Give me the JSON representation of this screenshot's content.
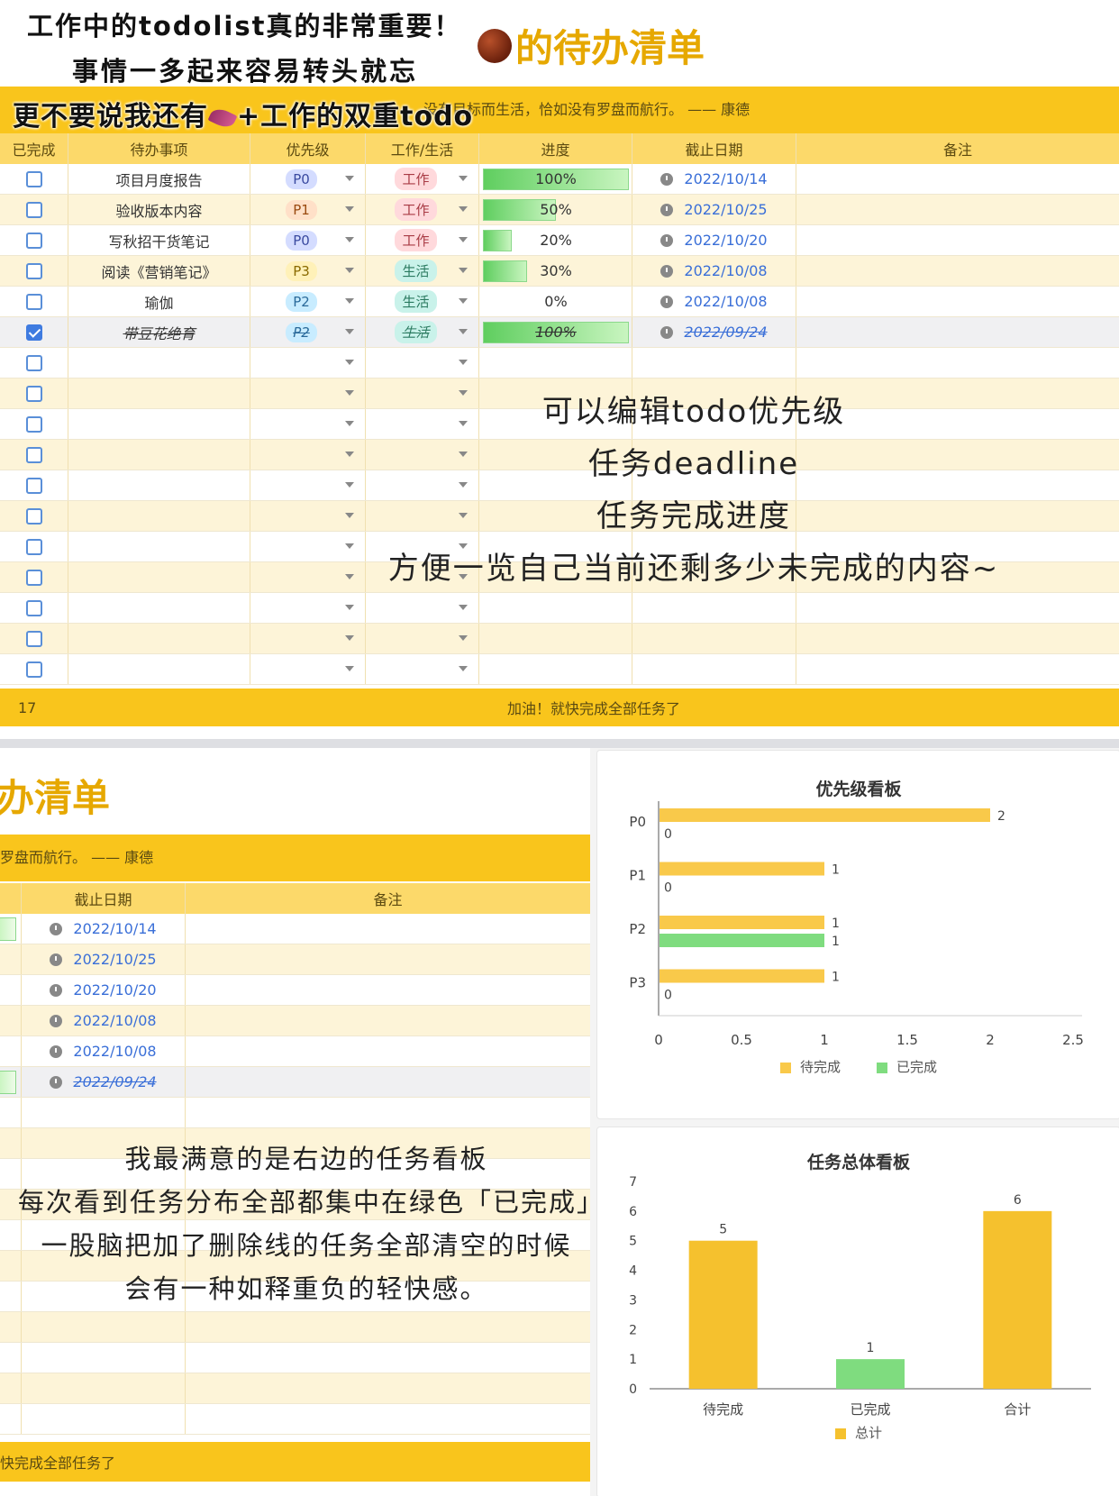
{
  "top": {
    "caption_line1": "工作中的todolist真的非常重要！",
    "caption_line2": "事情一多起来容易转头就忘",
    "caption_line3_a": "更不要说我还有",
    "caption_line3_b": "+工作的双重todo",
    "app_title": "的待办清单",
    "quote": "没有目标而生活，恰如没有罗盘而航行。 —— 康德",
    "headers": [
      "已完成",
      "待办事项",
      "优先级",
      "工作/生活",
      "进度",
      "截止日期",
      "备注"
    ],
    "rows": [
      {
        "done": false,
        "task": "项目月度报告",
        "priority": "P0",
        "type": "工作",
        "progress": 100,
        "progress_label": "100%",
        "due": "2022/10/14"
      },
      {
        "done": false,
        "task": "验收版本内容",
        "priority": "P1",
        "type": "工作",
        "progress": 50,
        "progress_label": "50%",
        "due": "2022/10/25"
      },
      {
        "done": false,
        "task": "写秋招干货笔记",
        "priority": "P0",
        "type": "工作",
        "progress": 20,
        "progress_label": "20%",
        "due": "2022/10/20"
      },
      {
        "done": false,
        "task": "阅读《营销笔记》",
        "priority": "P3",
        "type": "生活",
        "progress": 30,
        "progress_label": "30%",
        "due": "2022/10/08"
      },
      {
        "done": false,
        "task": "瑜伽",
        "priority": "P2",
        "type": "生活",
        "progress": 0,
        "progress_label": "0%",
        "due": "2022/10/08"
      },
      {
        "done": true,
        "task": "带豆花绝育",
        "priority": "P2",
        "type": "生活",
        "progress": 100,
        "progress_label": "100%",
        "due": "2022/09/24"
      }
    ],
    "empty_rows": 11,
    "footer_count": "17",
    "footer_text": "加油！就快完成全部任务了",
    "overlay": [
      "可以编辑todo优先级",
      "任务deadline",
      "任务完成进度",
      "方便一览自己当前还剩多少未完成的内容~"
    ]
  },
  "bottom": {
    "title_fragment": "办清单",
    "quote_fragment": "罗盘而航行。 —— 康德",
    "headers": [
      "截止日期",
      "备注"
    ],
    "dates": [
      "2022/10/14",
      "2022/10/25",
      "2022/10/20",
      "2022/10/08",
      "2022/10/08",
      "2022/09/24"
    ],
    "footer_fragment": "快完成全部任务了",
    "overlay": [
      "我最满意的是右边的任务看板",
      "每次看到任务分布全部都集中在绿色「已完成」",
      "一股脑把加了删除线的任务全部清空的时候",
      "会有一种如释重负的轻快感。"
    ]
  },
  "chart_data": [
    {
      "type": "bar",
      "orientation": "horizontal",
      "title": "优先级看板",
      "categories": [
        "P0",
        "P1",
        "P2",
        "P3"
      ],
      "series": [
        {
          "name": "待完成",
          "values": [
            2,
            1,
            1,
            1
          ],
          "color": "#f9c94a"
        },
        {
          "name": "已完成",
          "values": [
            0,
            0,
            1,
            0
          ],
          "color": "#7fdc7f"
        }
      ],
      "xlim": [
        0,
        2.5
      ],
      "xticks": [
        "0",
        "0.5",
        "1",
        "1.5",
        "2",
        "2.5"
      ],
      "legend": "bottom"
    },
    {
      "type": "bar",
      "title": "任务总体看板",
      "categories": [
        "待完成",
        "已完成",
        "合计"
      ],
      "series": [
        {
          "name": "总计",
          "values": [
            5,
            1,
            6
          ],
          "colors": [
            "#f5c12e",
            "#7fdc7f",
            "#f5c12e"
          ]
        }
      ],
      "ylim": [
        0,
        7
      ],
      "yticks": [
        "0",
        "1",
        "2",
        "3",
        "4",
        "5",
        "6",
        "7"
      ],
      "legend": "bottom"
    }
  ],
  "colors": {
    "brand_yellow": "#f9c51c",
    "header_yellow": "#fcd96a",
    "title_orange": "#e6a800",
    "date_blue": "#3a6fd8",
    "done_green": "#7fdc7f"
  }
}
